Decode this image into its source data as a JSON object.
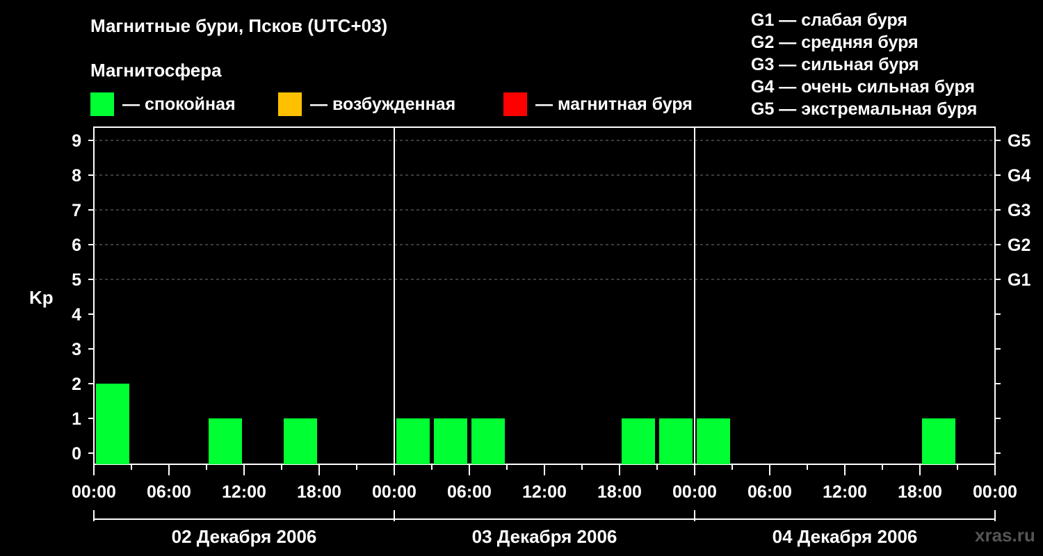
{
  "title": "Магнитные бури, Псков (UTC+03)",
  "subtitle": "Магнитосфера",
  "legend": {
    "calm": {
      "label": "— спокойная",
      "color": "#00ff33"
    },
    "excited": {
      "label": "— возбужденная",
      "color": "#ffc000"
    },
    "storm": {
      "label": "— магнитная буря",
      "color": "#ff0000"
    }
  },
  "g_scale": [
    "G1 — слабая буря",
    "G2 — средняя буря",
    "G3 — сильная буря",
    "G4 — очень сильная буря",
    "G5 — экстремальная буря"
  ],
  "watermark": "xras.ru",
  "chart_data": {
    "type": "bar",
    "ylabel": "Kp",
    "ylim": [
      0,
      9
    ],
    "yticks": [
      0,
      1,
      2,
      3,
      4,
      5,
      6,
      7,
      8,
      9
    ],
    "right_ticks": [
      {
        "value": 5,
        "label": "G1"
      },
      {
        "value": 6,
        "label": "G2"
      },
      {
        "value": 7,
        "label": "G3"
      },
      {
        "value": 8,
        "label": "G4"
      },
      {
        "value": 9,
        "label": "G5"
      }
    ],
    "grid": "horizontal dashed at Kp 5–9",
    "x_tick_labels": [
      "00:00",
      "06:00",
      "12:00",
      "18:00",
      "00:00",
      "06:00",
      "12:00",
      "18:00",
      "00:00",
      "06:00",
      "12:00",
      "18:00",
      "00:00"
    ],
    "days": [
      "02 Декабря 2006",
      "03 Декабря 2006",
      "04 Декабря 2006"
    ],
    "interval_hours": 3,
    "series": [
      {
        "day": "02 Декабря 2006",
        "values": [
          2,
          0,
          0,
          1,
          0,
          1,
          0,
          0
        ]
      },
      {
        "day": "03 Декабря 2006",
        "values": [
          1,
          1,
          1,
          0,
          0,
          0,
          1,
          1
        ]
      },
      {
        "day": "04 Декабря 2006",
        "values": [
          1,
          0,
          0,
          0,
          0,
          0,
          1,
          0
        ]
      }
    ],
    "bar_color": "#00ff33"
  }
}
